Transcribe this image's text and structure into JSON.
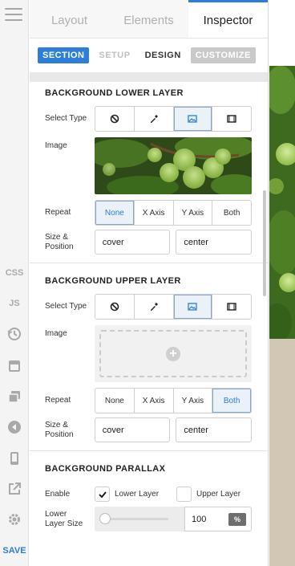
{
  "top_tabs": {
    "layout": "Layout",
    "elements": "Elements",
    "inspector": "Inspector"
  },
  "sub_tabs": {
    "section": "SECTION",
    "setup": "SETUP",
    "design": "DESIGN",
    "customize": "CUSTOMIZE"
  },
  "rail": {
    "css": "CSS",
    "js": "JS",
    "save": "SAVE"
  },
  "lower_layer": {
    "title": "BACKGROUND LOWER LAYER",
    "select_type_label": "Select Type",
    "image_label": "Image",
    "repeat_label": "Repeat",
    "repeat_options": [
      "None",
      "X Axis",
      "Y Axis",
      "Both"
    ],
    "repeat_selected": "None",
    "size_label_1": "Size &",
    "size_label_2": "Position",
    "size_value": "cover",
    "position_value": "center"
  },
  "upper_layer": {
    "title": "BACKGROUND UPPER LAYER",
    "select_type_label": "Select Type",
    "image_label": "Image",
    "repeat_label": "Repeat",
    "repeat_options": [
      "None",
      "X Axis",
      "Y Axis",
      "Both"
    ],
    "repeat_selected": "Both",
    "size_label_1": "Size &",
    "size_label_2": "Position",
    "size_value": "cover",
    "position_value": "center"
  },
  "parallax": {
    "title": "BACKGROUND PARALLAX",
    "enable_label": "Enable",
    "lower_layer_label": "Lower Layer",
    "lower_layer_checked": true,
    "upper_layer_label": "Upper Layer",
    "upper_layer_checked": false,
    "size_label_1": "Lower",
    "size_label_2": "Layer Size",
    "size_value": "100",
    "size_unit": "%"
  },
  "colors": {
    "accent": "#2c7ed6",
    "canvas_below": "#d2c6b4"
  }
}
